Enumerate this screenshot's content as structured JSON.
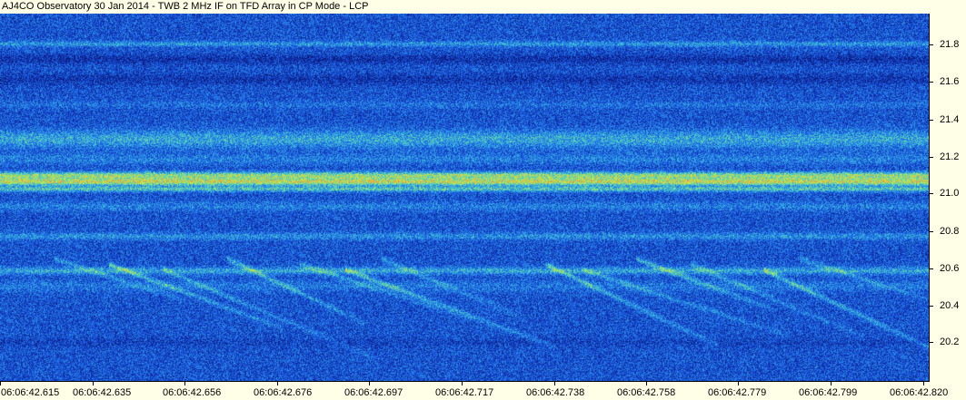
{
  "window": {
    "title": "AJ4CO Observatory 30 Jan 2014 - TWB 2 MHz IF on TFD Array in CP Mode - LCP"
  },
  "spectrogram": {
    "colormap": [
      "#0a1a78",
      "#1236b8",
      "#1a5ce0",
      "#2a8ae8",
      "#3cc0d8",
      "#7ee08a",
      "#d8e640",
      "#f09a3a",
      "#e06060"
    ]
  },
  "axes": {
    "y_ticks": [
      "21.8",
      "21.6",
      "21.4",
      "21.2",
      "21.0",
      "20.8",
      "20.6",
      "20.4",
      "20.2"
    ],
    "x_ticks": [
      "06:06:42.615",
      "06:06:42.635",
      "06:06:42.656",
      "06:06:42.676",
      "06:06:42.697",
      "06:06:42.717",
      "06:06:42.738",
      "06:06:42.758",
      "06:06:42.779",
      "06:06:42.799",
      "06:06:42.820"
    ]
  }
}
